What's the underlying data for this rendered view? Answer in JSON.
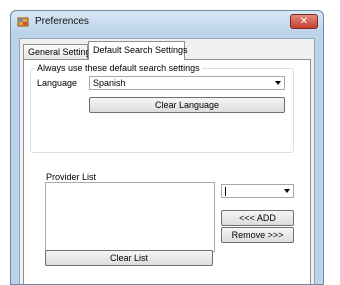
{
  "window": {
    "title": "Preferences",
    "close_glyph": "✕"
  },
  "tabs": [
    {
      "label": "General Settings",
      "selected": false
    },
    {
      "label": "Default Search Settings",
      "selected": true
    }
  ],
  "search_settings": {
    "group_label": "Always use these default search settings",
    "language_label": "Language",
    "language_value": "Spanish",
    "clear_language_label": "Clear Language",
    "provider_list_label": "Provider List",
    "provider_items": [],
    "provider_combo_value": "",
    "add_label": "<<< ADD",
    "remove_label": "Remove >>>",
    "clear_list_label": "Clear List"
  },
  "icons": {
    "app": "preferences-app-icon",
    "close": "close-icon",
    "dropdown": "chevron-down-icon"
  }
}
